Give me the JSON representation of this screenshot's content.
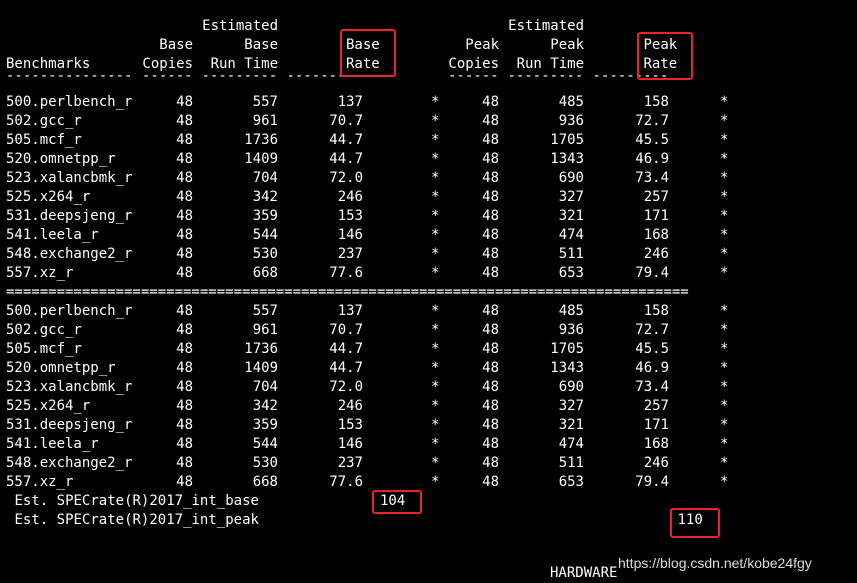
{
  "header": {
    "line1": {
      "col3": "Estimated",
      "col7": "Estimated"
    },
    "line2": {
      "col2": "Base",
      "col3": "Base",
      "col4": "Base",
      "col6": "Peak",
      "col7": "Peak",
      "col8": "Peak"
    },
    "line3": {
      "col1": "Benchmarks",
      "col2": "Copies",
      "col3": "Run Time",
      "col4": "Rate",
      "col6": "Copies",
      "col7": "Run Time",
      "col8": "Rate"
    }
  },
  "dashes": {
    "col1": "---------------",
    "col2": "------",
    "col3": "---------",
    "col4": "---------",
    "col6": "------",
    "col7": "---------",
    "col8": "---------"
  },
  "separator": "=================================================================================",
  "rows": [
    {
      "name": "500.perlbench_r",
      "bc": "48",
      "bt": "557",
      "br": "137",
      "bs": "*",
      "pc": "48",
      "pt": "485",
      "pr": "158",
      "ps": "*"
    },
    {
      "name": "502.gcc_r",
      "bc": "48",
      "bt": "961",
      "br": "70.7",
      "bs": "*",
      "pc": "48",
      "pt": "936",
      "pr": "72.7",
      "ps": "*"
    },
    {
      "name": "505.mcf_r",
      "bc": "48",
      "bt": "1736",
      "br": "44.7",
      "bs": "*",
      "pc": "48",
      "pt": "1705",
      "pr": "45.5",
      "ps": "*"
    },
    {
      "name": "520.omnetpp_r",
      "bc": "48",
      "bt": "1409",
      "br": "44.7",
      "bs": "*",
      "pc": "48",
      "pt": "1343",
      "pr": "46.9",
      "ps": "*"
    },
    {
      "name": "523.xalancbmk_r",
      "bc": "48",
      "bt": "704",
      "br": "72.0",
      "bs": "*",
      "pc": "48",
      "pt": "690",
      "pr": "73.4",
      "ps": "*"
    },
    {
      "name": "525.x264_r",
      "bc": "48",
      "bt": "342",
      "br": "246",
      "bs": "*",
      "pc": "48",
      "pt": "327",
      "pr": "257",
      "ps": "*"
    },
    {
      "name": "531.deepsjeng_r",
      "bc": "48",
      "bt": "359",
      "br": "153",
      "bs": "*",
      "pc": "48",
      "pt": "321",
      "pr": "171",
      "ps": "*"
    },
    {
      "name": "541.leela_r",
      "bc": "48",
      "bt": "544",
      "br": "146",
      "bs": "*",
      "pc": "48",
      "pt": "474",
      "pr": "168",
      "ps": "*"
    },
    {
      "name": "548.exchange2_r",
      "bc": "48",
      "bt": "530",
      "br": "237",
      "bs": "*",
      "pc": "48",
      "pt": "511",
      "pr": "246",
      "ps": "*"
    },
    {
      "name": "557.xz_r",
      "bc": "48",
      "bt": "668",
      "br": "77.6",
      "bs": "*",
      "pc": "48",
      "pt": "653",
      "pr": "79.4",
      "ps": "*"
    }
  ],
  "summary": {
    "base_label": "Est. SPECrate(R)2017_int_base",
    "base_value": "104",
    "peak_label": "Est. SPECrate(R)2017_int_peak",
    "peak_value": "110"
  },
  "cutoff_text": "HARDWARE",
  "watermark": "https://blog.csdn.net/kobe24fgy",
  "colors": {
    "background": "#000000",
    "text": "#ffffff",
    "highlight_box": "#e8232a"
  }
}
